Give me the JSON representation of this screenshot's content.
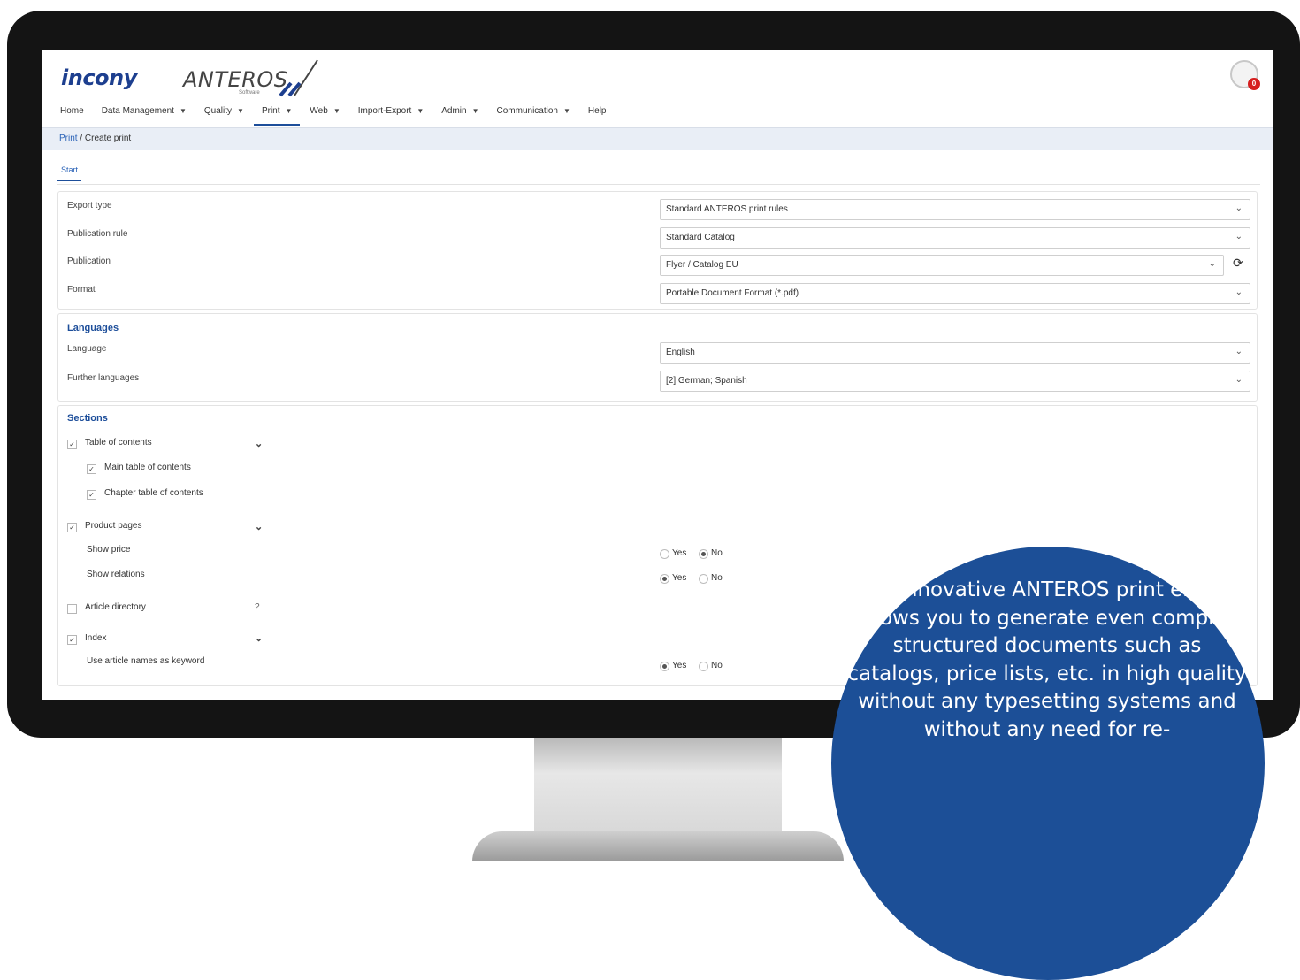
{
  "brand": {
    "company": "incony",
    "product": "ANTEROS",
    "product_sub": "Software"
  },
  "user": {
    "notification_count": "0"
  },
  "nav": [
    {
      "label": "Home",
      "has_menu": false
    },
    {
      "label": "Data Management",
      "has_menu": true
    },
    {
      "label": "Quality",
      "has_menu": true
    },
    {
      "label": "Print",
      "has_menu": true,
      "active": true
    },
    {
      "label": "Web",
      "has_menu": true
    },
    {
      "label": "Import-Export",
      "has_menu": true
    },
    {
      "label": "Admin",
      "has_menu": true
    },
    {
      "label": "Communication",
      "has_menu": true
    },
    {
      "label": "Help",
      "has_menu": false
    }
  ],
  "breadcrumb": {
    "parent": "Print",
    "separator": "/",
    "current": "Create print"
  },
  "tab": {
    "label": "Start"
  },
  "settings": {
    "export_type": {
      "label": "Export type",
      "value": "Standard ANTEROS print rules"
    },
    "publication_rule": {
      "label": "Publication rule",
      "value": "Standard Catalog"
    },
    "publication": {
      "label": "Publication",
      "value": "Flyer / Catalog EU"
    },
    "format": {
      "label": "Format",
      "value": "Portable Document Format (*.pdf)"
    }
  },
  "languages": {
    "title": "Languages",
    "language": {
      "label": "Language",
      "value": "English"
    },
    "further": {
      "label": "Further languages",
      "value": "[2] German; Spanish"
    }
  },
  "sections": {
    "title": "Sections",
    "toc": "Table of contents",
    "main_toc": "Main table of contents",
    "chapter_toc": "Chapter table of contents",
    "product_pages": "Product pages",
    "show_price": "Show price",
    "show_relations": "Show relations",
    "article_directory": "Article directory",
    "index": "Index",
    "use_article_names": "Use article names as keyword",
    "help_glyph": "?",
    "yes": "Yes",
    "no": "No"
  },
  "promo": {
    "text": "The innovative ANTEROS print engine allows you to generate even complex structured documents such as catalogs, price lists, etc. in high quality without any typesetting systems and without any need for re-"
  },
  "colors": {
    "brand_blue": "#1c4f97",
    "bezel": "#141414",
    "alert": "#d61f1f"
  },
  "icons": {
    "chevron": "chevron-down-icon",
    "refresh": "refresh-icon",
    "help": "question-icon"
  }
}
